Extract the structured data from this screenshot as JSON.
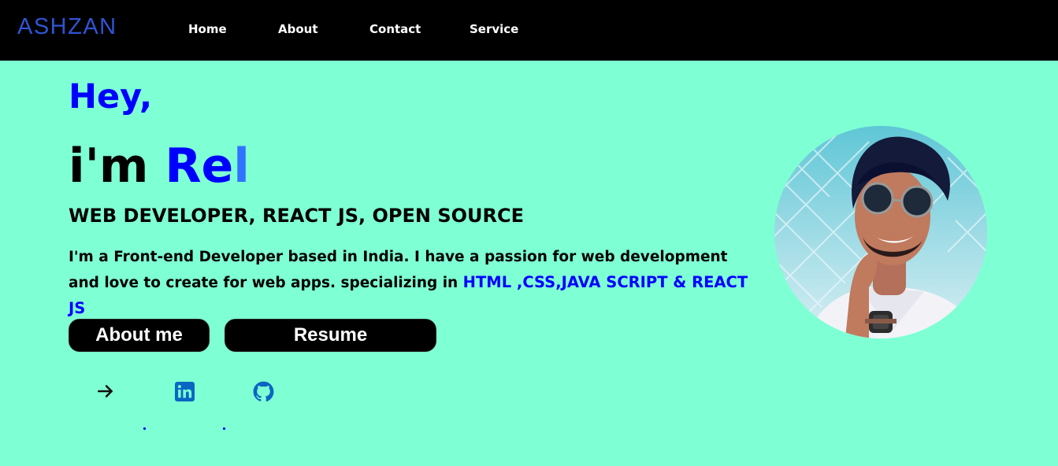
{
  "nav": {
    "brand": "ASHZAN",
    "links": [
      "Home",
      "About",
      "Contact",
      "Service"
    ]
  },
  "hero": {
    "greeting": "Hey,",
    "intro_prefix": "i'm ",
    "typed_name": "Re",
    "cursor": "l",
    "roles": "WEB DEVELOPER, REACT JS, OPEN SOURCE",
    "bio_text": "I'm a Front-end Developer based in India. I have a passion for web development and love to create for web apps. specializing in ",
    "bio_skills": "HTML ,CSS,JAVA SCRIPT & REACT JS"
  },
  "buttons": {
    "about": "About me",
    "resume": "Resume"
  },
  "social_icons": [
    "arrow-right-icon",
    "linkedin-icon",
    "github-icon"
  ],
  "colors": {
    "background": "#7fffd4",
    "navbar": "#000000",
    "brand": "#2f54d4",
    "accent": "#0000ff",
    "icon_blue": "#0a66c2"
  }
}
